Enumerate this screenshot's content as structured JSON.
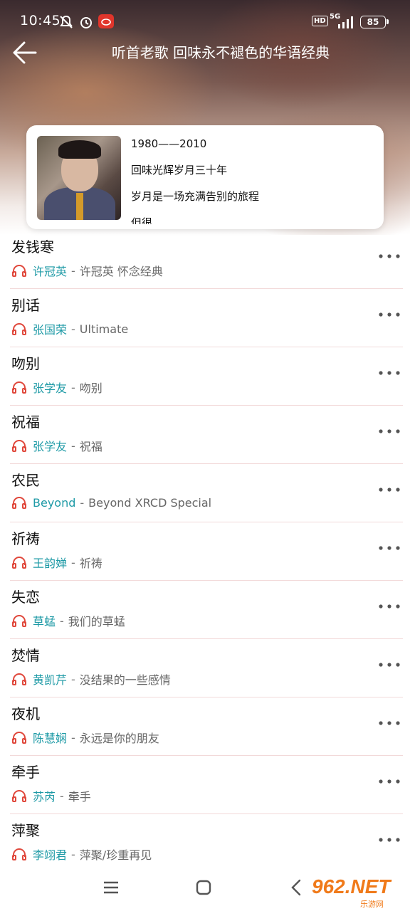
{
  "status_bar": {
    "time": "10:45",
    "network": "5G",
    "hd": "HD",
    "battery": "85"
  },
  "header": {
    "title": "听首老歌  回味永不褪色的华语经典"
  },
  "playlist": {
    "description_lines": [
      "1980——2010",
      "回味光辉岁月三十年",
      "岁月是一场充满告别的旅程",
      "但很"
    ]
  },
  "songs": [
    {
      "title": "发钱寒",
      "artist": "许冠英",
      "album": "许冠英 怀念经典"
    },
    {
      "title": "别话",
      "artist": "张国荣",
      "album": "Ultimate"
    },
    {
      "title": "吻别",
      "artist": "张学友",
      "album": "吻别"
    },
    {
      "title": "祝福",
      "artist": "张学友",
      "album": "祝福"
    },
    {
      "title": "农民",
      "artist": "Beyond",
      "album": "Beyond XRCD Special"
    },
    {
      "title": "祈祷",
      "artist": "王韵婵",
      "album": "祈祷"
    },
    {
      "title": "失恋",
      "artist": "草蜢",
      "album": "我们的草蜢"
    },
    {
      "title": "焚情",
      "artist": "黄凯芹",
      "album": "没结果的一些感情"
    },
    {
      "title": "夜机",
      "artist": "陈慧娴",
      "album": "永远是你的朋友"
    },
    {
      "title": "牵手",
      "artist": "苏芮",
      "album": "牵手"
    },
    {
      "title": "萍聚",
      "artist": "李翊君",
      "album": "萍聚/珍重再见"
    }
  ],
  "separator": "-",
  "watermark": {
    "main": "962.NET",
    "sub": "乐游网"
  },
  "colors": {
    "artist": "#1e9aa6",
    "headphone": "#e0483c",
    "divider": "#f2d9d9"
  }
}
